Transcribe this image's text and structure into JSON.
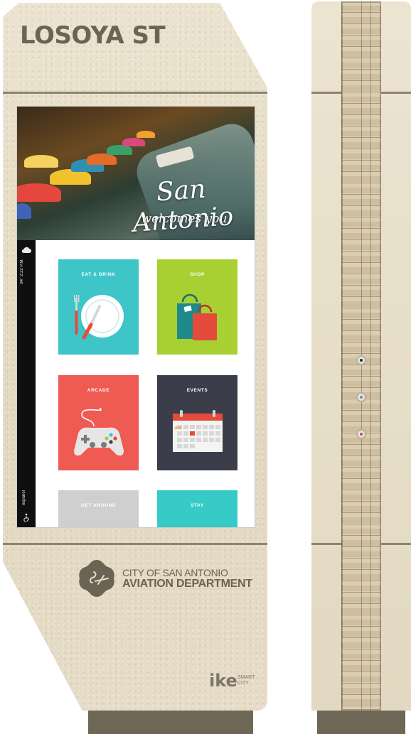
{
  "kiosk": {
    "street_name": "LOSOYA ST"
  },
  "screen": {
    "hero": {
      "title": "San Antonio",
      "subtitle": "welcomes you"
    },
    "sidebar": {
      "temperature": "84° 2:22 P.M.",
      "language": "español"
    },
    "tiles": [
      {
        "label": "EAT & DRINK",
        "color": "#3ec5c8",
        "icon": "plate-utensils-icon"
      },
      {
        "label": "SHOP",
        "color": "#a8d033",
        "icon": "shopping-bags-icon"
      },
      {
        "label": "ARCADE",
        "color": "#ef5a52",
        "icon": "game-controller-icon"
      },
      {
        "label": "EVENTS",
        "color": "#3b3e4a",
        "icon": "calendar-icon"
      },
      {
        "label": "GET AROUND",
        "color": "#cfcfcf",
        "icon": ""
      },
      {
        "label": "STAY",
        "color": "#36cbc6",
        "icon": ""
      }
    ],
    "calendar_month": "JUN"
  },
  "branding": {
    "city_line1": "CITY OF SAN ANTONIO",
    "city_line2": "AVIATION DEPARTMENT",
    "ike_logo": "ike",
    "ike_tag_line1": "SMART",
    "ike_tag_line2": "CITY"
  },
  "colors": {
    "stone_face": "#e6dcc6",
    "groove": "#8d836f",
    "base": "#6f6756"
  }
}
